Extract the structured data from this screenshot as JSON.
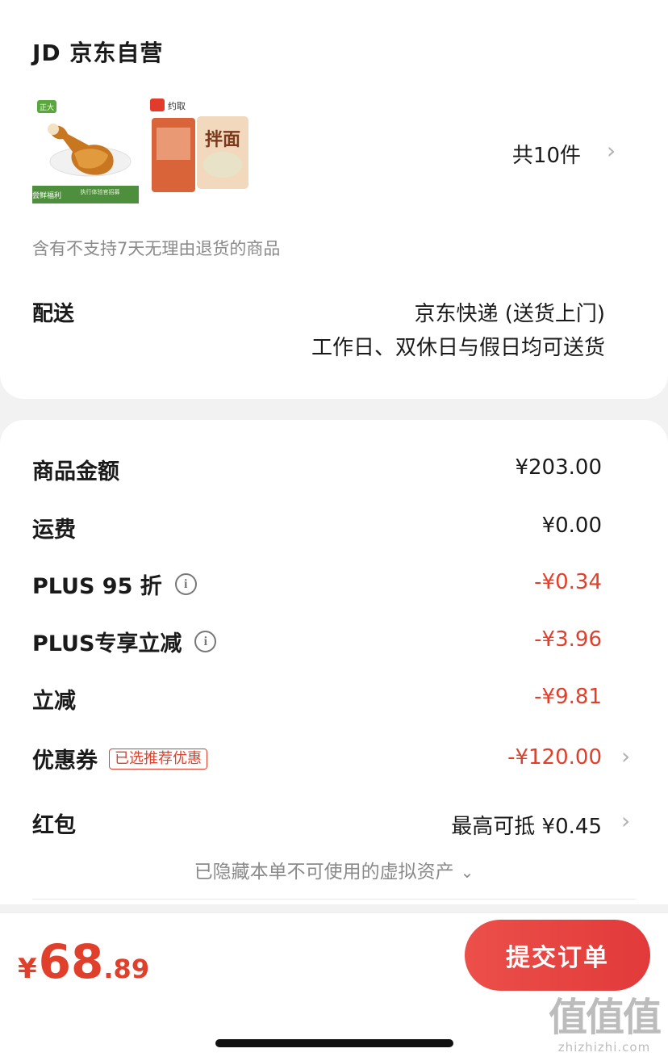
{
  "shop": {
    "name": "JD 京东自营"
  },
  "products": [
    {
      "name": "chicken-leg",
      "brand_badge": "正大",
      "banner_title": "尝鲜福利",
      "banner_text": "执行体验官招募"
    },
    {
      "name": "noodle-pack",
      "brand_logo": "约取",
      "package_text": "拌面"
    }
  ],
  "items_count": "共10件",
  "no_return_notice": "含有不支持7天无理由退货的商品",
  "delivery": {
    "label": "配送",
    "method": "京东快递 (送货上门)",
    "schedule": "工作日、双休日与假日均可送货"
  },
  "summary": [
    {
      "label": "商品金额",
      "value": "¥203.00"
    },
    {
      "label": "运费",
      "value": "¥0.00"
    },
    {
      "label": "PLUS 95 折",
      "value": "-¥0.34"
    },
    {
      "label": "PLUS专享立减",
      "value": "-¥3.96"
    },
    {
      "label": "立减",
      "value": "-¥9.81"
    },
    {
      "label": "优惠券",
      "tag": "已选推荐优惠",
      "value": "-¥120.00"
    },
    {
      "label": "红包",
      "value": "最高可抵 ¥0.45"
    }
  ],
  "hidden_assets_text": "已隐藏本单不可使用的虚拟资产",
  "total": {
    "currency": "¥",
    "integer": "68",
    "decimal": ".89"
  },
  "submit_label": "提交订单",
  "watermark": {
    "glyphs": "值值值",
    "url": "zhizhizhi.com"
  },
  "colors": {
    "accent": "#e0402b",
    "button": "#e8474a",
    "background": "#f2f2f2"
  },
  "icons": [
    "chevron-right-icon",
    "info-icon",
    "chevron-down-icon"
  ]
}
